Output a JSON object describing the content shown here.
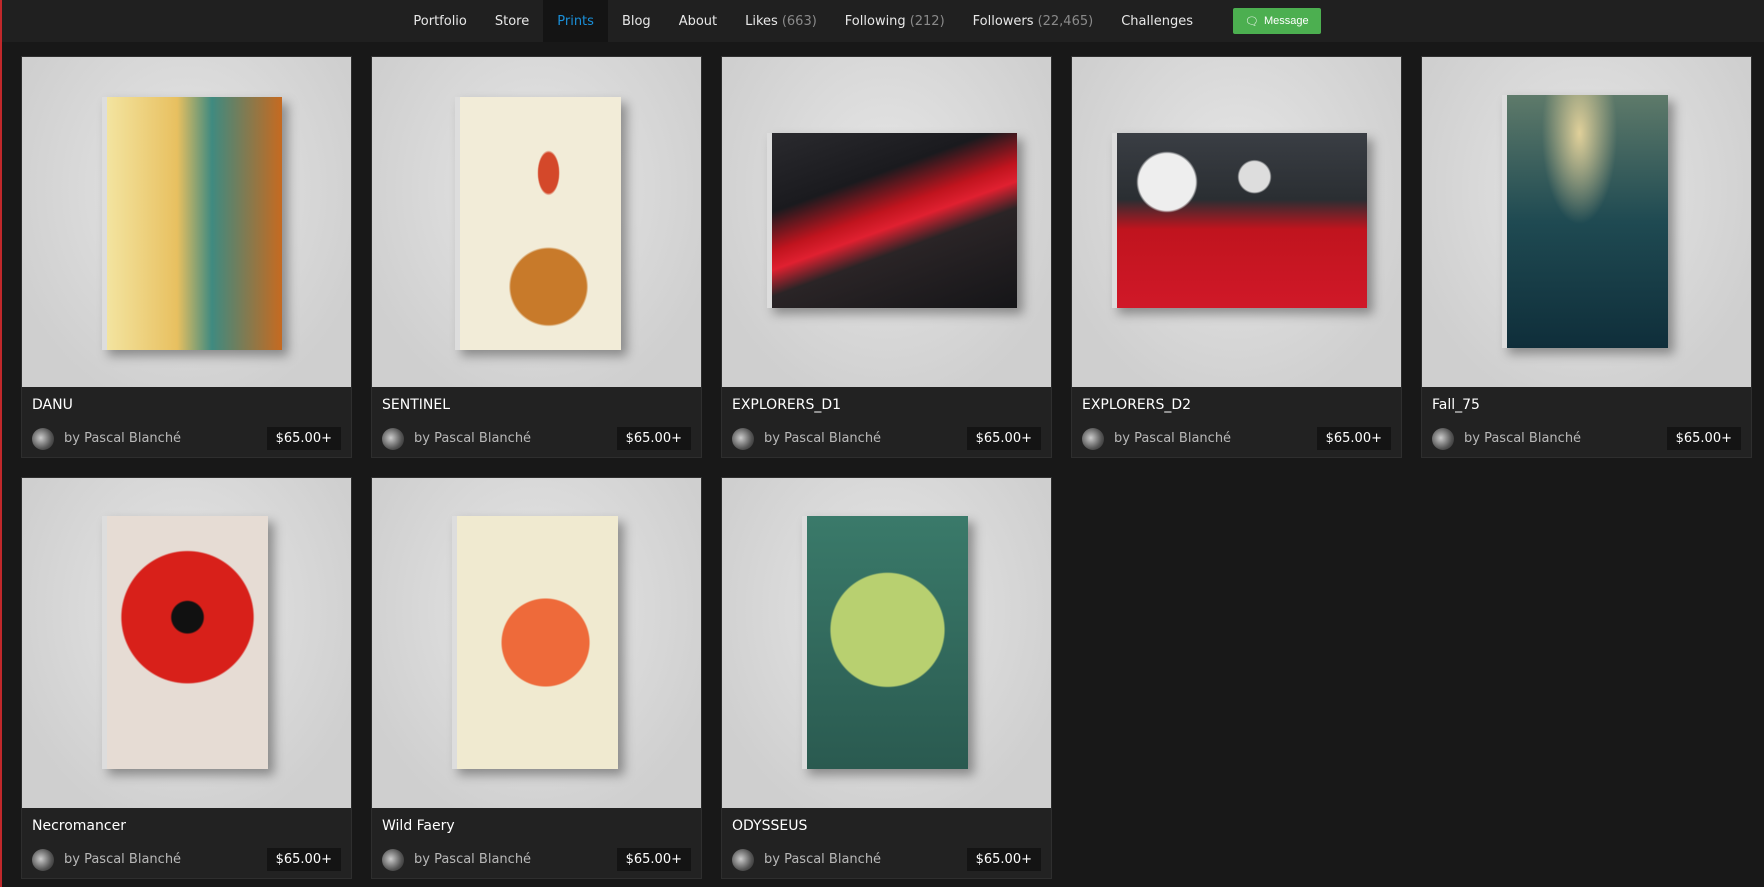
{
  "nav": {
    "items": [
      {
        "label": "Portfolio"
      },
      {
        "label": "Store"
      },
      {
        "label": "Prints",
        "active": true
      },
      {
        "label": "Blog"
      },
      {
        "label": "About"
      },
      {
        "label": "Likes",
        "count": "(663)"
      },
      {
        "label": "Following",
        "count": "(212)"
      },
      {
        "label": "Followers",
        "count": "(22,465)"
      },
      {
        "label": "Challenges"
      }
    ],
    "message_label": "Message"
  },
  "prints": [
    {
      "title": "DANU",
      "author": "by Pascal Blanché",
      "price": "$65.00+"
    },
    {
      "title": "SENTINEL",
      "author": "by Pascal Blanché",
      "price": "$65.00+"
    },
    {
      "title": "EXPLORERS_D1",
      "author": "by Pascal Blanché",
      "price": "$65.00+"
    },
    {
      "title": "EXPLORERS_D2",
      "author": "by Pascal Blanché",
      "price": "$65.00+"
    },
    {
      "title": "Fall_75",
      "author": "by Pascal Blanché",
      "price": "$65.00+"
    },
    {
      "title": "Necromancer",
      "author": "by Pascal Blanché",
      "price": "$65.00+"
    },
    {
      "title": "Wild Faery",
      "author": "by Pascal Blanché",
      "price": "$65.00+"
    },
    {
      "title": "ODYSSEUS",
      "author": "by Pascal Blanché",
      "price": "$65.00+"
    }
  ]
}
